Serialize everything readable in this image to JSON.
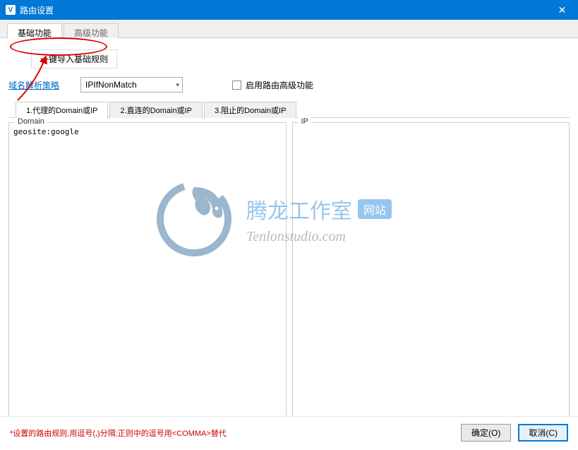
{
  "titlebar": {
    "icon": "V",
    "title": "路由设置"
  },
  "mainTabs": [
    {
      "label": "基础功能",
      "active": true
    },
    {
      "label": "高级功能",
      "active": false
    }
  ],
  "importButton": "一键导入基础规则",
  "strategy": {
    "label": "域名解析策略",
    "value": "IPIfNonMatch"
  },
  "advancedCheckbox": {
    "label": "启用路由高级功能",
    "checked": false
  },
  "subTabs": [
    {
      "label": "1.代理的Domain或IP",
      "active": true
    },
    {
      "label": "2.直连的Domain或IP",
      "active": false
    },
    {
      "label": "3.阻止的Domain或IP",
      "active": false
    }
  ],
  "fields": {
    "domain": {
      "legend": "Domain",
      "value": "geosite:google"
    },
    "ip": {
      "legend": "IP",
      "value": ""
    }
  },
  "footer": {
    "note": "*设置的路由规则,用逗号(,)分隔;正则中的逗号用<COMMA>替代",
    "ok": "确定(O)",
    "cancel": "取消(C)"
  },
  "watermark": {
    "title": "腾龙工作室",
    "badge": "网站",
    "sub": "Tenlonstudio.com"
  }
}
